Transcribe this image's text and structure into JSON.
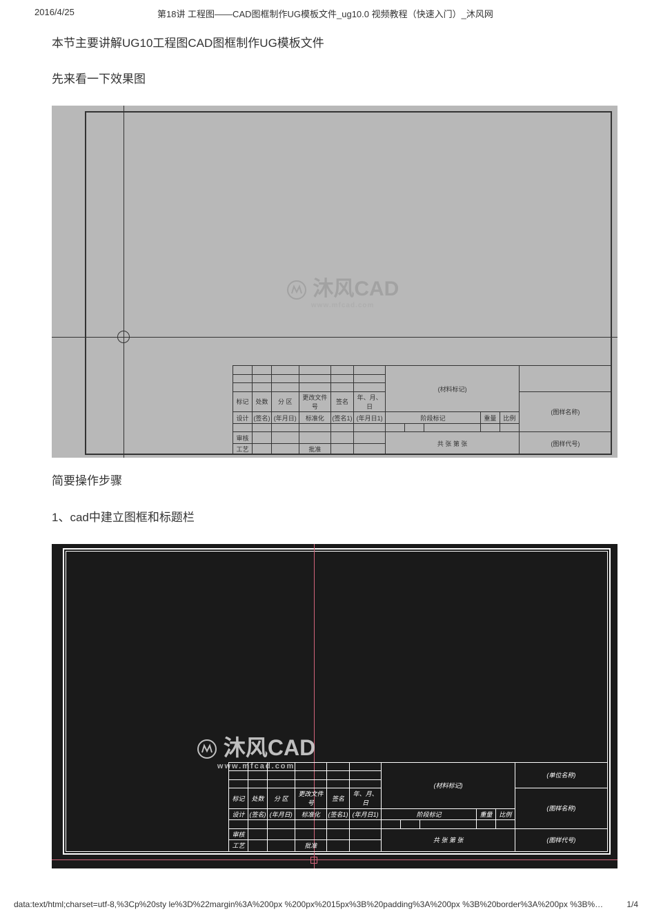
{
  "header": {
    "date": "2016/4/25",
    "title": "第18讲 工程图——CAD图框制作UG模板文件_ug10.0 视频教程（快速入门）_沐风网"
  },
  "content": {
    "p1": "本节主要讲解UG10工程图CAD图框制作UG模板文件",
    "p2": "先来看一下效果图",
    "p3": "简要操作步骤",
    "p4": "1、cad中建立图框和标题栏"
  },
  "watermark": {
    "main": "沐风CAD",
    "sub": "www.mfcad.com"
  },
  "titleblock1": {
    "material_mark": "(材料标记)",
    "drawing_name": "(图样名称)",
    "drawing_code": "(图样代号)",
    "row_labels": {
      "mark": "标记",
      "count": "处数",
      "zone": "分 区",
      "change_doc": "更改文件号",
      "sign": "签名",
      "date": "年、月、日",
      "design": "设计",
      "signer": "(签名)",
      "ymd": "(年月日)",
      "standardize": "标准化",
      "signer1": "(签名1)",
      "ymd1": "(年月日1)",
      "stage_mark": "阶段标记",
      "weight": "重量",
      "scale": "比例",
      "review": "审核",
      "craft": "工艺",
      "approve": "批准",
      "sheet_total": "共  张  第  张"
    }
  },
  "titleblock2": {
    "company_name": "(单位名称)",
    "material_mark": "(材料标记)",
    "drawing_name": "(图样名称)",
    "drawing_code": "(图样代号)",
    "row_labels": {
      "mark": "标记",
      "count": "处数",
      "zone": "分 区",
      "change_doc": "更改文件号",
      "sign": "签名",
      "date": "年、月、日",
      "design": "设计",
      "signer": "(签名)",
      "ymd": "(年月日)",
      "standardize": "标准化",
      "signer1": "(签名1)",
      "ymd1": "(年月日1)",
      "stage_mark": "阶段标记",
      "weight": "重量",
      "scale": "比例",
      "review": "审核",
      "craft": "工艺",
      "approve": "批准",
      "sheet_total": "共  张  第  张"
    }
  },
  "footer": {
    "url": "data:text/html;charset=utf-8,%3Cp%20sty  le%3D%22margin%3A%200px  %200px%2015px%3B%20padding%3A%200px  %3B%20border%3A%200px %3B%…",
    "page": "1/4"
  }
}
